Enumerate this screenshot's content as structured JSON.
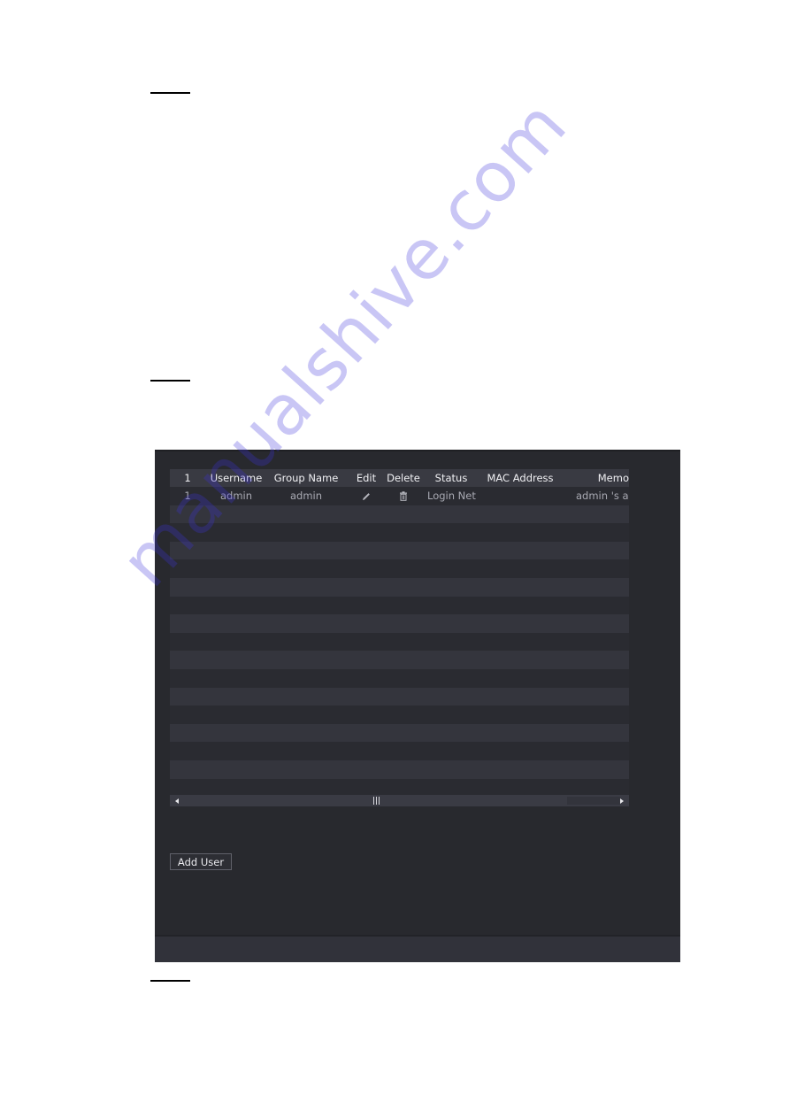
{
  "document": {
    "step_markers": [
      "step-marker-1",
      "step-marker-2",
      "step-marker-3"
    ]
  },
  "user_table": {
    "columns": [
      "1",
      "Username",
      "Group Name",
      "Edit",
      "Delete",
      "Status",
      "MAC Address",
      "Memo"
    ],
    "header_visible_memo": "Memo",
    "rows": [
      {
        "index": "1",
        "username": "admin",
        "group_name": "admin",
        "edit_icon": "pencil-icon",
        "delete_icon": "trash-icon",
        "status": "Login Net",
        "mac_address": "",
        "memo": "admin 's account"
      }
    ],
    "empty_row_count": 16,
    "horizontal_scroll": {
      "left_arrow": "scroll-left-icon",
      "right_arrow": "scroll-right-icon",
      "grip_icon": "grip-icon"
    }
  },
  "buttons": {
    "add_user": "Add User"
  },
  "watermark": {
    "text": "manualshive.com",
    "color": "#3c32dc"
  },
  "colors": {
    "panel_bg": "#28292e",
    "header_bg": "#393a42",
    "row_odd": "#34353d",
    "row_even": "#2a2b31"
  }
}
